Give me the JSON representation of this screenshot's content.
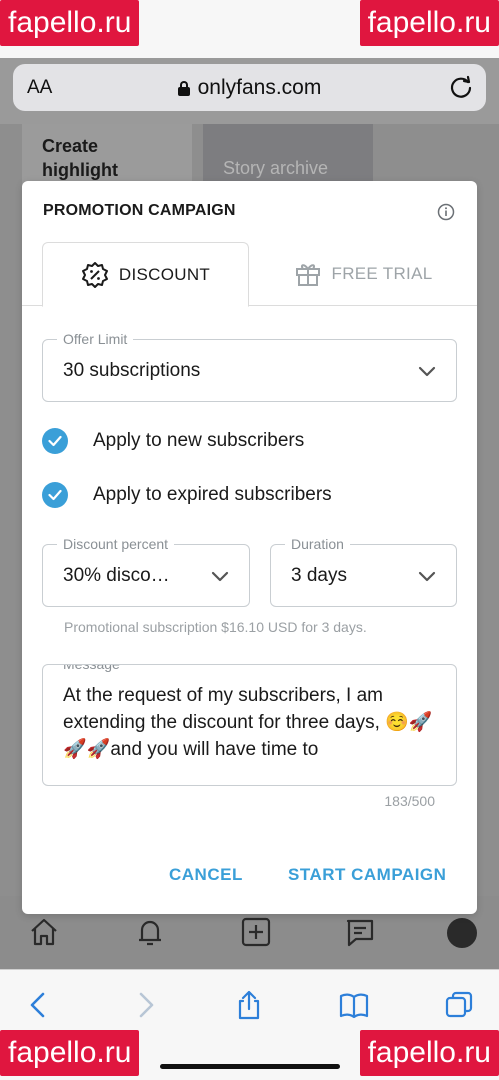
{
  "browser": {
    "text_size_label": "AA",
    "url": "onlyfans.com"
  },
  "background": {
    "highlight_label": "Create highlight",
    "archive_label": "Story archive"
  },
  "modal": {
    "title": "PROMOTION CAMPAIGN",
    "tabs": [
      {
        "label": "DISCOUNT",
        "active": true
      },
      {
        "label": "FREE TRIAL",
        "active": false
      }
    ],
    "offer_limit": {
      "label": "Offer Limit",
      "value": "30 subscriptions"
    },
    "checkboxes": [
      {
        "label": "Apply to new subscribers",
        "checked": true
      },
      {
        "label": "Apply to expired subscribers",
        "checked": true
      }
    ],
    "discount_percent": {
      "label": "Discount percent",
      "value": "30% disco…"
    },
    "duration": {
      "label": "Duration",
      "value": "3 days"
    },
    "promo_note": "Promotional subscription $16.10 USD for 3 days.",
    "message": {
      "label": "Message",
      "value": "At the request of my subscribers, I am extending the discount for three  days, ☺️🚀🚀🚀and you will have time to"
    },
    "char_counter": "183/500",
    "cancel_label": "CANCEL",
    "start_label": "START CAMPAIGN"
  },
  "watermark": "fapello.ru",
  "colors": {
    "accent": "#3a9fd8",
    "watermark_bg": "#e0163f"
  }
}
